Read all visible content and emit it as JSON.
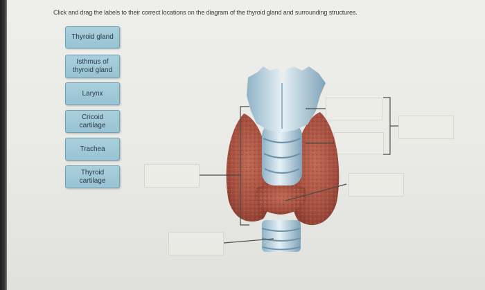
{
  "question": {
    "instruction": "Click and drag the labels to their correct locations on the diagram of the thyroid gland and surrounding structures."
  },
  "labels": [
    {
      "text": "Thyroid gland"
    },
    {
      "text": "Isthmus of thyroid gland"
    },
    {
      "text": "Larynx"
    },
    {
      "text": "Cricoid cartilage"
    },
    {
      "text": "Trachea"
    },
    {
      "text": "Thyroid cartilage"
    }
  ],
  "drop_zones_count": 6,
  "colors": {
    "tile_fill": "#a9cfdc",
    "tile_border": "#6e9fb3",
    "thyroid_tissue": "#b25a48",
    "cartilage": "#c4dde8",
    "leader_line": "#4a4a4a"
  }
}
